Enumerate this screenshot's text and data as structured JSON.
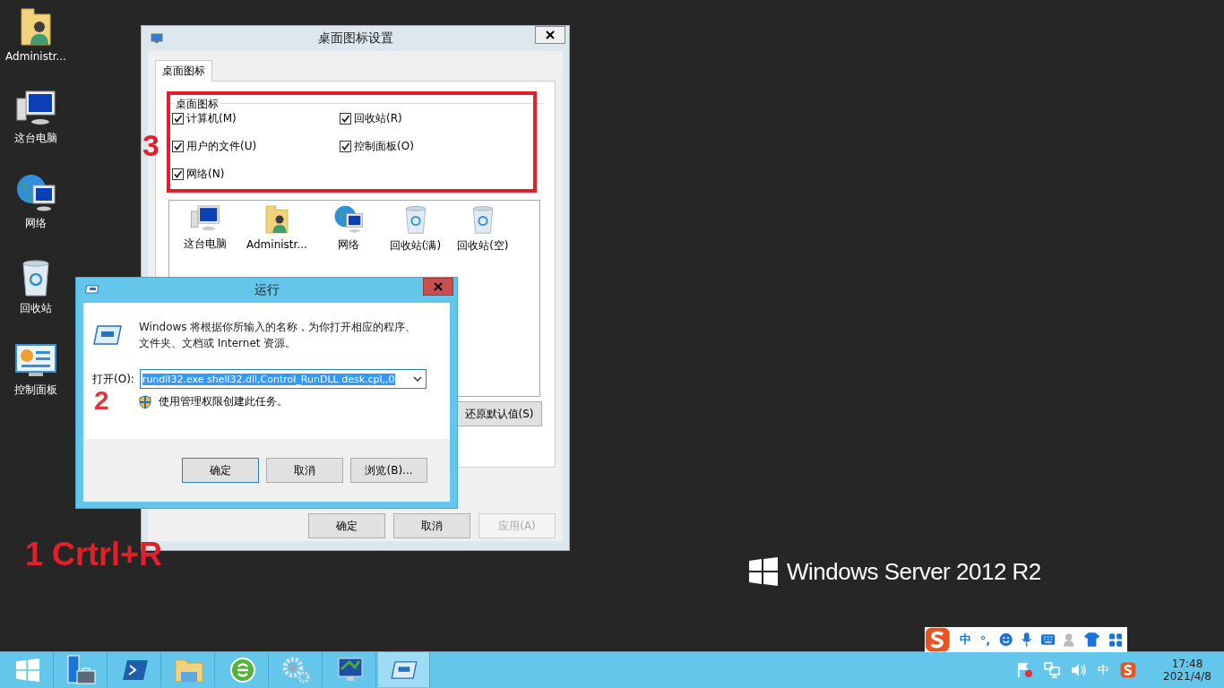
{
  "desktop_icons": [
    {
      "label": "Administr...",
      "kind": "user-folder"
    },
    {
      "label": "这台电脑",
      "kind": "computer"
    },
    {
      "label": "网络",
      "kind": "network"
    },
    {
      "label": "回收站",
      "kind": "recycle-empty"
    },
    {
      "label": "控制面板",
      "kind": "control-panel"
    }
  ],
  "icon_settings_dialog": {
    "title": "桌面图标设置",
    "tabs": [
      {
        "label": "桌面图标",
        "selected": true
      }
    ],
    "group_title": "桌面图标",
    "checkboxes": [
      {
        "label": "计算机(M)",
        "checked": true
      },
      {
        "label": "回收站(R)",
        "checked": true
      },
      {
        "label": "用户的文件(U)",
        "checked": true
      },
      {
        "label": "控制面板(O)",
        "checked": true
      },
      {
        "label": "网络(N)",
        "checked": true
      }
    ],
    "preview_icons": [
      {
        "label": "这台电脑",
        "kind": "computer"
      },
      {
        "label": "Administr...",
        "kind": "user-folder"
      },
      {
        "label": "网络",
        "kind": "network"
      },
      {
        "label": "回收站(满)",
        "kind": "recycle-full"
      },
      {
        "label": "回收站(空)",
        "kind": "recycle-empty"
      }
    ],
    "restore_button": "还原默认值(S)",
    "buttons": [
      {
        "label": "确定",
        "disabled": false
      },
      {
        "label": "取消",
        "disabled": false
      },
      {
        "label": "应用(A)",
        "disabled": true
      }
    ]
  },
  "run_dialog": {
    "title": "运行",
    "message": "Windows 将根据你所输入的名称，为你打开相应的程序、文件夹、文档或 Internet 资源。",
    "open_label": "打开(O):",
    "command": "rundll32.exe shell32.dll,Control_RunDLL desk.cpl,,0",
    "admin_note": "使用管理权限创建此任务。",
    "buttons": [
      {
        "label": "确定",
        "default": true
      },
      {
        "label": "取消",
        "default": false
      },
      {
        "label": "浏览(B)...",
        "default": false
      }
    ]
  },
  "annotations": {
    "step_1": "1 Crtrl+R",
    "step_2": "2",
    "step_3": "3"
  },
  "brand": "Windows Server 2012 R2",
  "ime_toolbar": {
    "mode": "中",
    "punctuation": "°,"
  },
  "taskbar": {
    "apps": [
      {
        "kind": "start",
        "selected": false
      },
      {
        "kind": "server-manager",
        "selected": false
      },
      {
        "kind": "powershell",
        "selected": false
      },
      {
        "kind": "explorer",
        "selected": false
      },
      {
        "kind": "browser",
        "selected": false
      },
      {
        "kind": "settings",
        "selected": false
      },
      {
        "kind": "display",
        "selected": false
      },
      {
        "kind": "run",
        "selected": true
      }
    ],
    "tray_ime": "中",
    "time": "17:48",
    "date": "2021/4/8"
  }
}
